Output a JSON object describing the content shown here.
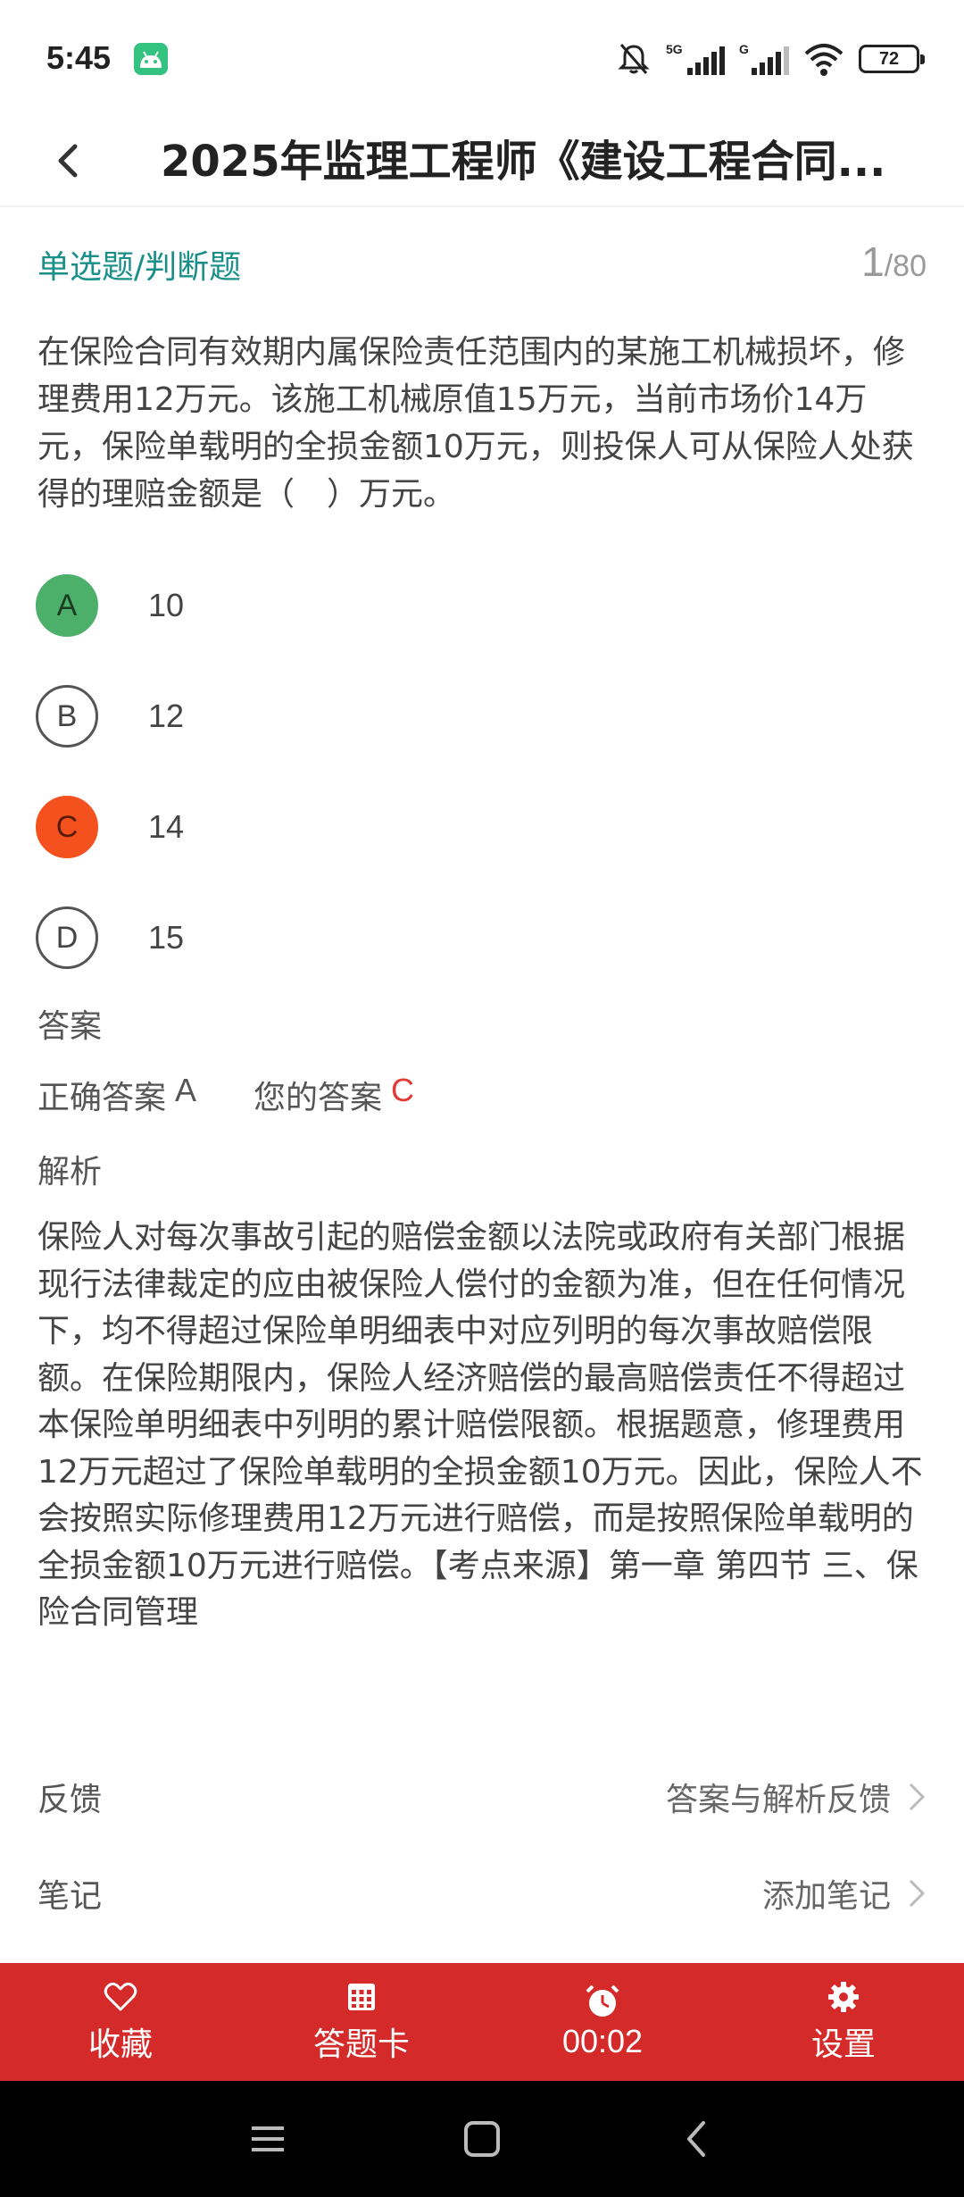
{
  "status_bar": {
    "time": "5:45",
    "battery": "72",
    "icons": [
      "android-notification-icon",
      "mute-icon",
      "signal-5g-icon",
      "signal-g-icon",
      "wifi-icon",
      "battery-icon"
    ]
  },
  "header": {
    "title": "2025年监理工程师《建设工程合同..."
  },
  "question": {
    "type_label": "单选题/判断题",
    "current": "1",
    "total": "/80",
    "text": "在保险合同有效期内属保险责任范围内的某施工机械损坏，修理费用12万元。该施工机械原值15万元，当前市场价14万元，保险单载明的全损金额10万元，则投保人可从保险人处获得的理赔金额是（　）万元。",
    "options": [
      {
        "letter": "A",
        "value": "10",
        "state": "correct"
      },
      {
        "letter": "B",
        "value": "12",
        "state": "normal"
      },
      {
        "letter": "C",
        "value": "14",
        "state": "wrong"
      },
      {
        "letter": "D",
        "value": "15",
        "state": "normal"
      }
    ]
  },
  "answer": {
    "section_label": "答案",
    "correct_label": "正确答案",
    "correct_letter": "A",
    "your_label": "您的答案",
    "your_letter": "C"
  },
  "analysis": {
    "section_label": "解析",
    "text": "保险人对每次事故引起的赔偿金额以法院或政府有关部门根据现行法律裁定的应由被保险人偿付的金额为准，但在任何情况下，均不得超过保险单明细表中对应列明的每次事故赔偿限额。在保险期限内，保险人经济赔偿的最高赔偿责任不得超过本保险单明细表中列明的累计赔偿限额。根据题意，修理费用12万元超过了保险单载明的全损金额10万元。因此，保险人不会按照实际修理费用12万元进行赔偿，而是按照保险单载明的全损金额10万元进行赔偿。【考点来源】第一章 第四节 三、保险合同管理"
  },
  "feedback": {
    "label": "反馈",
    "action": "答案与解析反馈"
  },
  "notes": {
    "label": "笔记",
    "action": "添加笔记"
  },
  "bottom_bar": {
    "color": "#d42a2a",
    "favorite": "收藏",
    "answer_card": "答题卡",
    "timer": "00:02",
    "settings": "设置"
  },
  "colors": {
    "accent_teal": "#1a8f8a",
    "correct_green": "#4caf6a",
    "wrong_orange": "#f4511e",
    "your_answer_red": "#e53935"
  }
}
